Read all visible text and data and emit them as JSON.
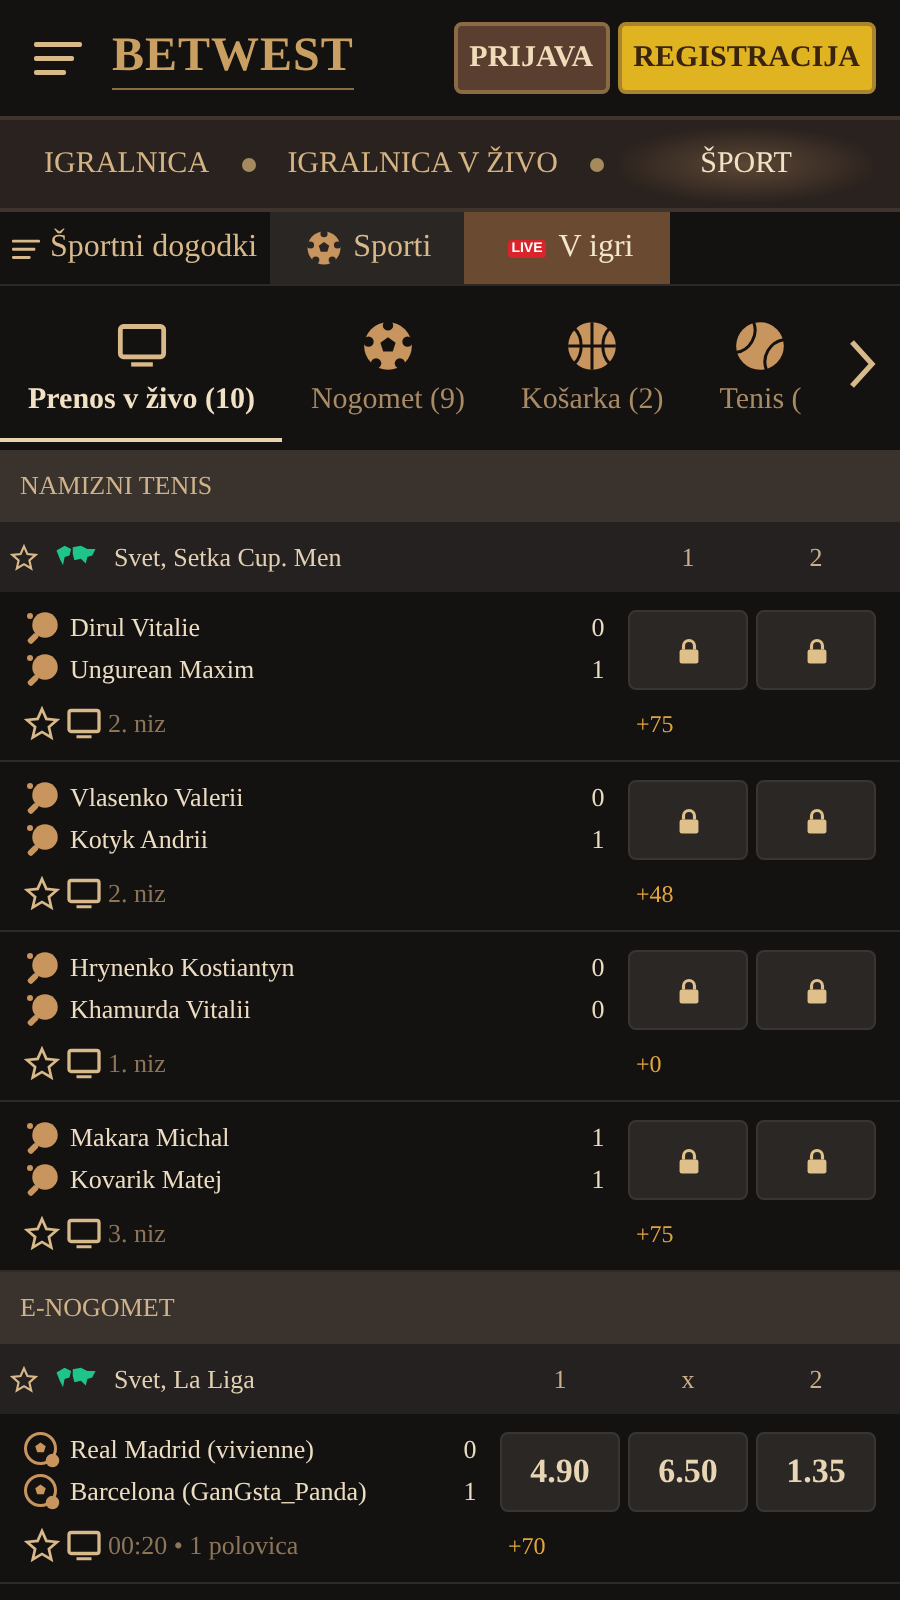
{
  "header": {
    "logo": "BETWEST",
    "buttons": [
      {
        "label": "PRIJAVA",
        "kind": "login"
      },
      {
        "label": "REGISTRACIJA",
        "kind": "register"
      }
    ]
  },
  "nav": [
    {
      "label": "IGRALNICA",
      "selected": false
    },
    {
      "label": "IGRALNICA V ŽIVO",
      "selected": false
    },
    {
      "label": "ŠPORT",
      "selected": true
    }
  ],
  "subnav": {
    "menu_label": "Športni dogodki",
    "tabs": [
      {
        "label": "Sporti",
        "kind": "sports",
        "selected": false
      },
      {
        "label": "V igri",
        "kind": "live",
        "badge": "LIVE",
        "selected": true
      }
    ]
  },
  "sport_tabs": [
    {
      "label": "Prenos v živo (10)",
      "kind": "tv",
      "selected": true
    },
    {
      "label": "Nogomet (9)",
      "kind": "football",
      "selected": false
    },
    {
      "label": "Košarka (2)",
      "kind": "basketball",
      "selected": false
    },
    {
      "label": "Tenis (",
      "kind": "tennis",
      "selected": false
    }
  ],
  "sections": [
    {
      "title": "NAMIZNI TENIS",
      "kind": "table-tennis",
      "league": "Svet, Setka Cup. Men",
      "columns": [
        "1",
        "2"
      ],
      "matches": [
        {
          "teams": [
            "Dirul Vitalie",
            "Ungurean Maxim"
          ],
          "scores": [
            "0",
            "1"
          ],
          "status": "2. niz",
          "extra": "+75",
          "odds": [
            {
              "locked": true
            },
            {
              "locked": true
            }
          ]
        },
        {
          "teams": [
            "Vlasenko Valerii",
            "Kotyk Andrii"
          ],
          "scores": [
            "0",
            "1"
          ],
          "status": "2. niz",
          "extra": "+48",
          "odds": [
            {
              "locked": true
            },
            {
              "locked": true
            }
          ]
        },
        {
          "teams": [
            "Hrynenko Kostiantyn",
            "Khamurda Vitalii"
          ],
          "scores": [
            "0",
            "0"
          ],
          "status": "1. niz",
          "extra": "+0",
          "odds": [
            {
              "locked": true
            },
            {
              "locked": true
            }
          ]
        },
        {
          "teams": [
            "Makara Michal",
            "Kovarik Matej"
          ],
          "scores": [
            "1",
            "1"
          ],
          "status": "3. niz",
          "extra": "+75",
          "odds": [
            {
              "locked": true
            },
            {
              "locked": true
            }
          ]
        }
      ]
    },
    {
      "title": "E-NOGOMET",
      "kind": "esoccer",
      "league": "Svet, La Liga",
      "columns": [
        "1",
        "x",
        "2"
      ],
      "matches": [
        {
          "teams": [
            "Real Madrid (vivienne)",
            "Barcelona (GanGsta_Panda)"
          ],
          "scores": [
            "0",
            "1"
          ],
          "status": "00:20 • 1 polovica",
          "extra": "+70",
          "odds": [
            {
              "locked": false,
              "value": "4.90"
            },
            {
              "locked": false,
              "value": "6.50"
            },
            {
              "locked": false,
              "value": "1.35"
            }
          ]
        }
      ]
    }
  ]
}
